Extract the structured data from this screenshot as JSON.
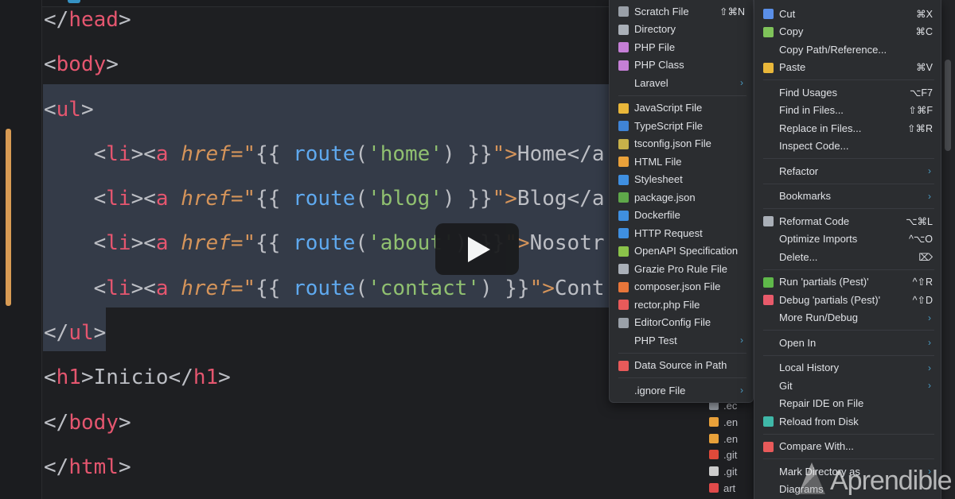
{
  "code": {
    "lines": [
      [
        "</",
        "head",
        ">"
      ],
      [
        "<",
        "body",
        ">"
      ],
      [
        "<",
        "ul",
        ">"
      ],
      {
        "tag": "li",
        "href_attr": "href",
        "fn": "route",
        "arg": "'home'",
        "text": "Home</a"
      },
      {
        "tag": "li",
        "href_attr": "href",
        "fn": "route",
        "arg": "'blog'",
        "text": "Blog</a"
      },
      {
        "tag": "li",
        "href_attr": "href",
        "fn": "route",
        "arg": "'about'",
        "text": "Nosotr"
      },
      {
        "tag": "li",
        "href_attr": "href",
        "fn": "route",
        "arg": "'contact'",
        "text": "Cont"
      },
      [
        "</",
        "ul",
        ">"
      ],
      [
        "<",
        "h1",
        ">Inicio</",
        "h1",
        ">"
      ],
      [
        "</",
        "body",
        ">"
      ],
      [
        "</",
        "html",
        ">"
      ]
    ]
  },
  "new_menu": {
    "items": [
      {
        "label": "Scratch File",
        "shortcut": "⇧⌘N",
        "icon": "scratch-file-icon",
        "color": "#9aa0a8"
      },
      {
        "label": "Directory",
        "icon": "folder-icon",
        "color": "#aab0b8"
      },
      {
        "label": "PHP File",
        "icon": "php-elephant-icon",
        "color": "#c57fd6"
      },
      {
        "label": "PHP Class",
        "icon": "php-elephant-icon",
        "color": "#c57fd6"
      },
      {
        "label": "Laravel",
        "submenu": true
      },
      {
        "separator": true
      },
      {
        "label": "JavaScript File",
        "icon": "js-icon",
        "color": "#e9b73a"
      },
      {
        "label": "TypeScript File",
        "icon": "ts-icon",
        "color": "#3f84d6"
      },
      {
        "label": "tsconfig.json File",
        "icon": "braces-icon",
        "color": "#c8b14a"
      },
      {
        "label": "HTML File",
        "icon": "html5-icon",
        "color": "#e9a13a"
      },
      {
        "label": "Stylesheet",
        "icon": "css3-icon",
        "color": "#3f8fe0"
      },
      {
        "label": "package.json",
        "icon": "nodejs-icon",
        "color": "#5fa84a"
      },
      {
        "label": "Dockerfile",
        "icon": "docker-icon",
        "color": "#3f8fe0"
      },
      {
        "label": "HTTP Request",
        "icon": "api-icon",
        "color": "#3f8fe0"
      },
      {
        "label": "OpenAPI Specification",
        "icon": "openapi-icon",
        "color": "#8bc34a"
      },
      {
        "label": "Grazie Pro Rule File",
        "icon": "leaf-icon",
        "color": "#aab0b8"
      },
      {
        "label": "composer.json File",
        "icon": "composer-icon",
        "color": "#e8763a"
      },
      {
        "label": "rector.php File",
        "icon": "rector-icon",
        "color": "#e85a5a"
      },
      {
        "label": "EditorConfig File",
        "icon": "editorconfig-icon",
        "color": "#9aa0a8"
      },
      {
        "label": "PHP Test",
        "submenu": true
      },
      {
        "separator": true
      },
      {
        "label": "Data Source in Path",
        "icon": "database-icon",
        "color": "#e85a5a"
      },
      {
        "separator": true
      },
      {
        "label": ".ignore File",
        "submenu": true
      }
    ]
  },
  "context_menu": {
    "items": [
      {
        "label": "Cut",
        "shortcut": "⌘X",
        "icon": "scissors-icon",
        "color": "#5a8fe8"
      },
      {
        "label": "Copy",
        "shortcut": "⌘C",
        "icon": "copy-icon",
        "color": "#7fc35a"
      },
      {
        "label": "Copy Path/Reference..."
      },
      {
        "label": "Paste",
        "shortcut": "⌘V",
        "icon": "clipboard-icon",
        "color": "#e9b73a"
      },
      {
        "separator": true
      },
      {
        "label": "Find Usages",
        "shortcut": "⌥F7"
      },
      {
        "label": "Find in Files...",
        "shortcut": "⇧⌘F"
      },
      {
        "label": "Replace in Files...",
        "shortcut": "⇧⌘R"
      },
      {
        "label": "Inspect Code..."
      },
      {
        "separator": true
      },
      {
        "label": "Refactor",
        "submenu": true
      },
      {
        "separator": true
      },
      {
        "label": "Bookmarks",
        "submenu": true
      },
      {
        "separator": true
      },
      {
        "label": "Reformat Code",
        "shortcut": "⌥⌘L",
        "icon": "reformat-icon",
        "color": "#aab0b8"
      },
      {
        "label": "Optimize Imports",
        "shortcut": "^⌥O"
      },
      {
        "label": "Delete...",
        "shortcut": "⌦"
      },
      {
        "separator": true
      },
      {
        "label": "Run 'partials (Pest)'",
        "shortcut": "^⇧R",
        "icon": "run-icon",
        "color": "#5fb84a"
      },
      {
        "label": "Debug 'partials (Pest)'",
        "shortcut": "^⇧D",
        "icon": "bug-icon",
        "color": "#e85a6a"
      },
      {
        "label": "More Run/Debug",
        "submenu": true
      },
      {
        "separator": true
      },
      {
        "label": "Open In",
        "submenu": true
      },
      {
        "separator": true
      },
      {
        "label": "Local History",
        "submenu": true
      },
      {
        "label": "Git",
        "submenu": true
      },
      {
        "label": "Repair IDE on File"
      },
      {
        "label": "Reload from Disk",
        "icon": "reload-icon",
        "color": "#3fb8a8"
      },
      {
        "separator": true
      },
      {
        "label": "Compare With...",
        "icon": "compare-icon",
        "color": "#e85a5a"
      },
      {
        "separator": true
      },
      {
        "label": "Mark Directory as",
        "submenu": true
      },
      {
        "label": "Diagrams"
      }
    ]
  },
  "project_tree": [
    {
      "label": ".ec",
      "color": "#9aa0a8"
    },
    {
      "label": ".en",
      "color": "#e9a13a"
    },
    {
      "label": ".en",
      "color": "#e9a13a"
    },
    {
      "label": ".git",
      "color": "#e04a3a"
    },
    {
      "label": ".git",
      "color": "#cccccc"
    },
    {
      "label": "art",
      "color": "#e04a4a"
    }
  ],
  "watermark": "Aprendible",
  "icons": {
    "submenu": "›",
    "play": "play-icon"
  }
}
